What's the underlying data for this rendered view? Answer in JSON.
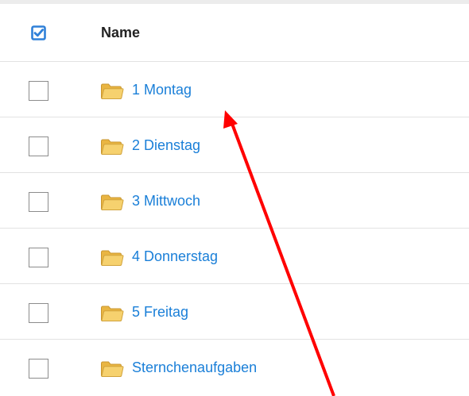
{
  "header": {
    "name_label": "Name"
  },
  "rows": [
    {
      "label": "1 Montag"
    },
    {
      "label": "2 Dienstag"
    },
    {
      "label": "3 Mittwoch"
    },
    {
      "label": "4 Donnerstag"
    },
    {
      "label": "5 Freitag"
    },
    {
      "label": "Sternchenaufgaben"
    }
  ],
  "colors": {
    "link": "#1a7fd8",
    "check_accent": "#2f80d8",
    "folder": "#f3c85a",
    "annotation_arrow": "#ff0000"
  },
  "icons": {
    "select_all": "checkbox-checked-icon",
    "folder": "folder-icon",
    "annotation": "red-arrow"
  }
}
